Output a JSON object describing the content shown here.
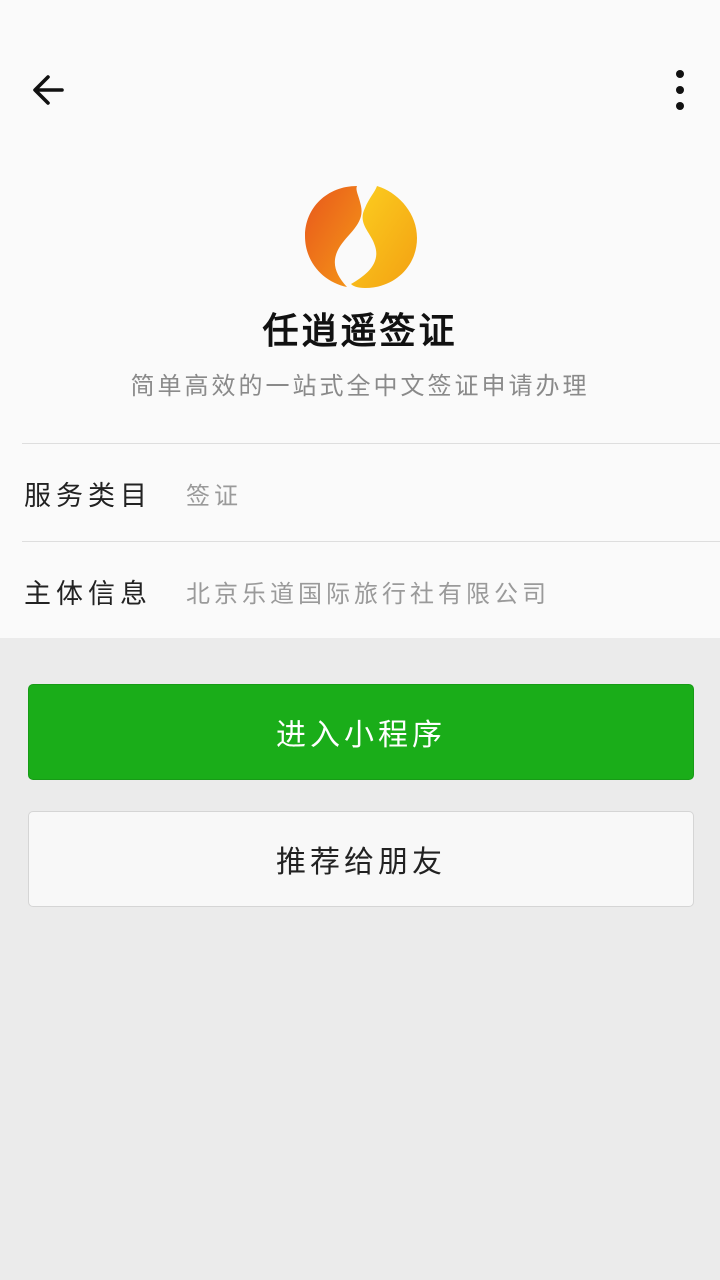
{
  "nav": {
    "back_icon": "arrow-left-icon",
    "more_icon": "more-vertical-icon"
  },
  "app": {
    "name": "任逍遥签证",
    "description": "简单高效的一站式全中文签证申请办理",
    "logo_colors": [
      "#e8571c",
      "#f5a81a",
      "#fcd020"
    ]
  },
  "info": {
    "service_label": "服务类目",
    "service_value": "签证",
    "entity_label": "主体信息",
    "entity_value": "北京乐道国际旅行社有限公司"
  },
  "actions": {
    "enter_label": "进入小程序",
    "share_label": "推荐给朋友"
  },
  "colors": {
    "primary": "#1aad19",
    "background": "#ebebeb",
    "panel": "#fafafa"
  }
}
